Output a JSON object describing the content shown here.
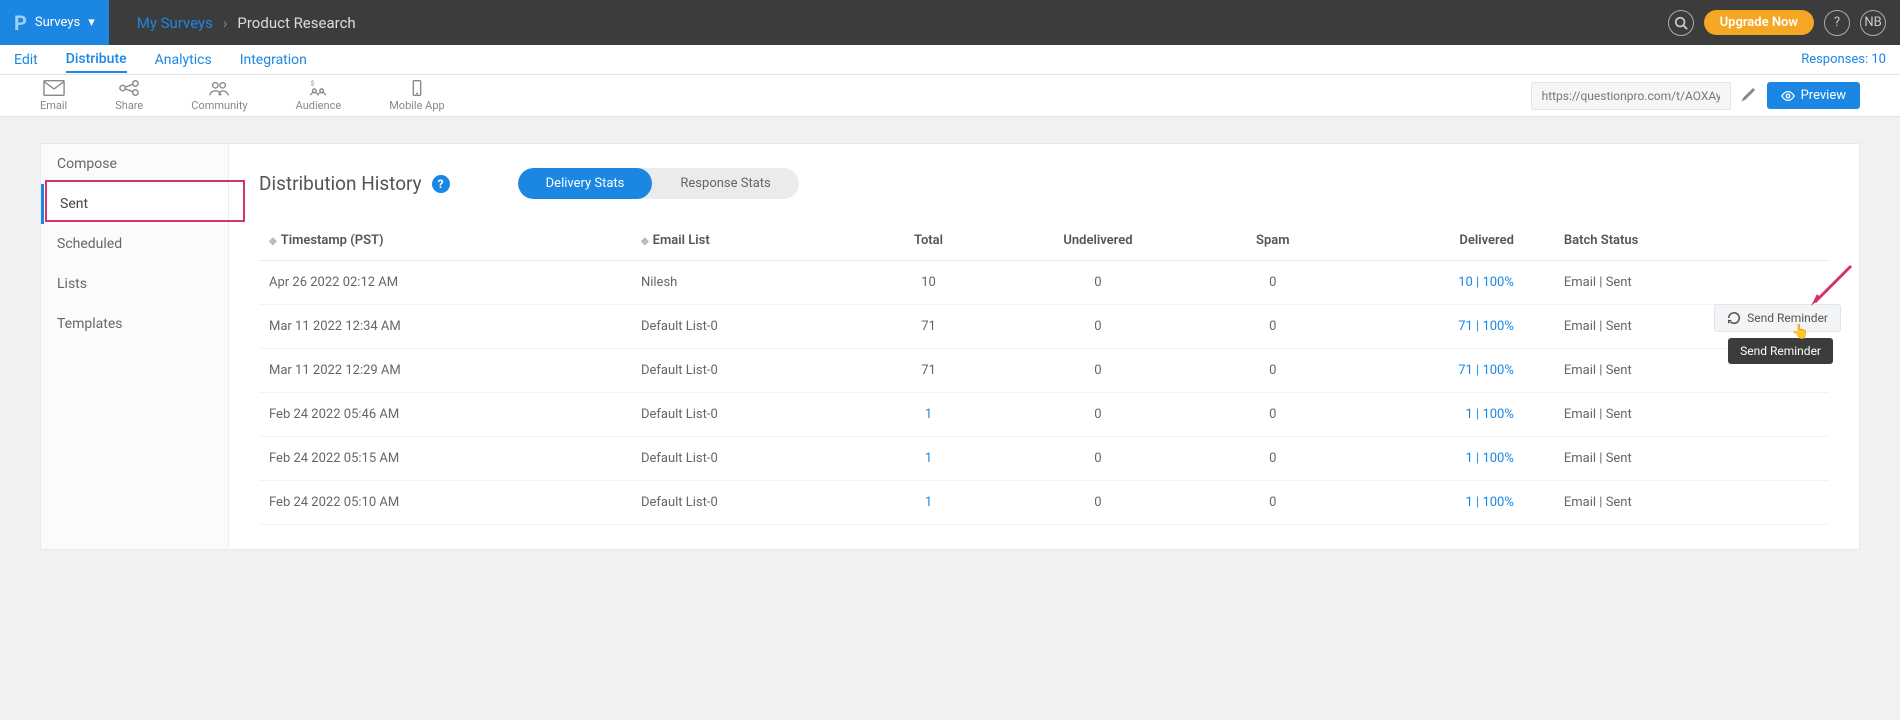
{
  "topbar": {
    "brand_initial": "P",
    "brand_label": "Surveys",
    "breadcrumb_link": "My Surveys",
    "breadcrumb_sep": "›",
    "breadcrumb_current": "Product Research",
    "upgrade_label": "Upgrade Now",
    "avatar": "NB"
  },
  "mainnav": {
    "items": [
      "Edit",
      "Distribute",
      "Analytics",
      "Integration"
    ],
    "active_index": 1,
    "responses_label": "Responses: 10"
  },
  "subbar": {
    "items": [
      {
        "label": "Email",
        "icon": "email-icon"
      },
      {
        "label": "Share",
        "icon": "share-icon"
      },
      {
        "label": "Community",
        "icon": "community-icon"
      },
      {
        "label": "Audience",
        "icon": "audience-icon"
      },
      {
        "label": "Mobile App",
        "icon": "mobile-icon"
      }
    ],
    "url_value": "https://questionpro.com/t/AOXAyZrIjI",
    "preview_label": "Preview"
  },
  "sidebar": {
    "items": [
      {
        "label": "Compose"
      },
      {
        "label": "Sent"
      },
      {
        "label": "Scheduled"
      },
      {
        "label": "Lists"
      },
      {
        "label": "Templates"
      }
    ],
    "active_index": 1
  },
  "main": {
    "title": "Distribution History",
    "tabs": {
      "delivery": "Delivery Stats",
      "response": "Response Stats"
    },
    "headers": {
      "timestamp": "Timestamp (PST)",
      "email_list": "Email List",
      "total": "Total",
      "undelivered": "Undelivered",
      "spam": "Spam",
      "delivered": "Delivered",
      "batch": "Batch Status"
    },
    "rows": [
      {
        "ts": "Apr 26 2022 02:12 AM",
        "list": "Nilesh",
        "total": "10",
        "undel": "0",
        "spam": "0",
        "del": "10 | 100%",
        "batch": "Email | Sent"
      },
      {
        "ts": "Mar 11 2022 12:34 AM",
        "list": "Default List-0",
        "total": "71",
        "undel": "0",
        "spam": "0",
        "del": "71 | 100%",
        "batch": "Email | Sent"
      },
      {
        "ts": "Mar 11 2022 12:29 AM",
        "list": "Default List-0",
        "total": "71",
        "undel": "0",
        "spam": "0",
        "del": "71 | 100%",
        "batch": "Email | Sent"
      },
      {
        "ts": "Feb 24 2022 05:46 AM",
        "list": "Default List-0",
        "total": "1",
        "undel": "0",
        "spam": "0",
        "del": "1 | 100%",
        "batch": "Email | Sent"
      },
      {
        "ts": "Feb 24 2022 05:15 AM",
        "list": "Default List-0",
        "total": "1",
        "undel": "0",
        "spam": "0",
        "del": "1 | 100%",
        "batch": "Email | Sent"
      },
      {
        "ts": "Feb 24 2022 05:10 AM",
        "list": "Default List-0",
        "total": "1",
        "undel": "0",
        "spam": "0",
        "del": "1 | 100%",
        "batch": "Email | Sent"
      }
    ],
    "reminder_label": "Send Reminder",
    "reminder_tooltip": "Send Reminder"
  }
}
